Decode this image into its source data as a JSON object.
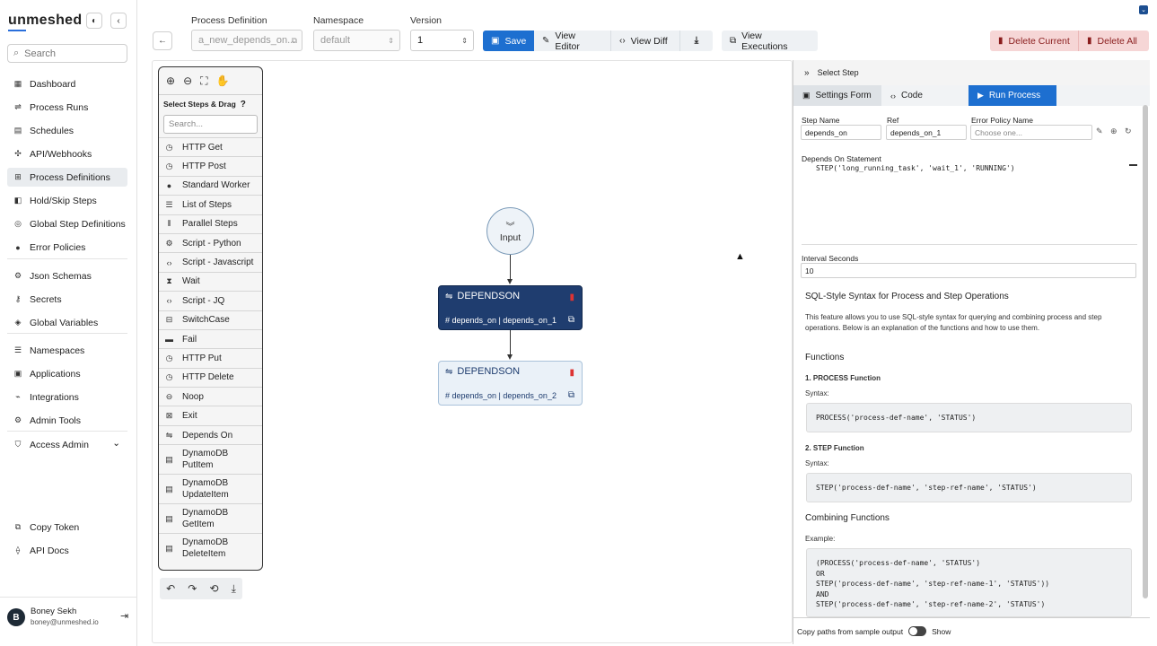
{
  "app": {
    "logo": "unmeshed"
  },
  "sidebar": {
    "search_placeholder": "Search",
    "items": [
      {
        "label": "Dashboard",
        "icon": "dashboard-icon"
      },
      {
        "label": "Process Runs",
        "icon": "runs-icon"
      },
      {
        "label": "Schedules",
        "icon": "calendar-icon"
      },
      {
        "label": "API/Webhooks",
        "icon": "webhook-icon"
      },
      {
        "label": "Process Definitions",
        "icon": "flow-icon",
        "active": true
      },
      {
        "label": "Hold/Skip Steps",
        "icon": "pause-icon"
      },
      {
        "label": "Global Step Definitions",
        "icon": "globe-icon"
      },
      {
        "label": "Error Policies",
        "icon": "warning-icon"
      },
      {
        "label": "Json Schemas",
        "icon": "schema-icon"
      },
      {
        "label": "Secrets",
        "icon": "key-icon"
      },
      {
        "label": "Global Variables",
        "icon": "variables-icon"
      },
      {
        "label": "Namespaces",
        "icon": "list-icon"
      },
      {
        "label": "Applications",
        "icon": "apps-icon"
      },
      {
        "label": "Integrations",
        "icon": "plug-icon"
      },
      {
        "label": "Admin Tools",
        "icon": "gear-icon"
      },
      {
        "label": "Access Admin",
        "icon": "shield-icon"
      }
    ],
    "bottom_items": [
      {
        "label": "Copy Token",
        "icon": "copy-icon"
      },
      {
        "label": "API Docs",
        "icon": "docs-icon"
      }
    ],
    "user": {
      "initial": "B",
      "name": "Boney Sekh",
      "email": "boney@unmeshed.io"
    }
  },
  "header": {
    "process_definition_label": "Process Definition",
    "process_definition_value": "a_new_depends_on...",
    "namespace_label": "Namespace",
    "namespace_value": "default",
    "version_label": "Version",
    "version_value": "1",
    "save": "Save",
    "view_editor": "View Editor",
    "view_diff": "View Diff",
    "view_executions": "View Executions",
    "delete_current": "Delete Current",
    "delete_all": "Delete All"
  },
  "palette": {
    "title": "Select Steps & Drag",
    "search_placeholder": "Search...",
    "items": [
      {
        "label": "HTTP Get",
        "icon": "http-icon"
      },
      {
        "label": "HTTP Post",
        "icon": "http-icon"
      },
      {
        "label": "Standard Worker",
        "icon": "worker-icon"
      },
      {
        "label": "List of Steps",
        "icon": "list-icon"
      },
      {
        "label": "Parallel Steps",
        "icon": "parallel-icon"
      },
      {
        "label": "Script - Python",
        "icon": "python-icon"
      },
      {
        "label": "Script - Javascript",
        "icon": "code-icon"
      },
      {
        "label": "Wait",
        "icon": "hourglass-icon"
      },
      {
        "label": "Script - JQ",
        "icon": "code-icon"
      },
      {
        "label": "SwitchCase",
        "icon": "switch-icon"
      },
      {
        "label": "Fail",
        "icon": "fail-icon"
      },
      {
        "label": "HTTP Put",
        "icon": "http-icon"
      },
      {
        "label": "HTTP Delete",
        "icon": "http-icon"
      },
      {
        "label": "Noop",
        "icon": "noop-icon"
      },
      {
        "label": "Exit",
        "icon": "exit-icon"
      },
      {
        "label": "Depends On",
        "icon": "link-icon"
      }
    ],
    "tall_items": [
      {
        "line1": "DynamoDB",
        "line2": "PutItem"
      },
      {
        "line1": "DynamoDB",
        "line2": "UpdateItem"
      },
      {
        "line1": "DynamoDB",
        "line2": "GetItem"
      },
      {
        "line1": "DynamoDB",
        "line2": "DeleteItem"
      }
    ]
  },
  "graph": {
    "input_label": "Input",
    "nodes": [
      {
        "title": "DEPENDSON",
        "sub": "# depends_on | depends_on_1",
        "selected": true
      },
      {
        "title": "DEPENDSON",
        "sub": "# depends_on | depends_on_2",
        "selected": false
      }
    ]
  },
  "panel": {
    "head": "Select Step",
    "tabs": {
      "settings": "Settings Form",
      "code": "Code",
      "run": "Run Process"
    },
    "step_name_label": "Step Name",
    "step_name_value": "depends_on",
    "ref_label": "Ref",
    "ref_value": "depends_on_1",
    "error_policy_label": "Error Policy Name",
    "error_policy_placeholder": "Choose one...",
    "depends_on_label": "Depends On Statement",
    "depends_on_value": "STEP('long_running_task', 'wait_1', 'RUNNING')",
    "interval_label": "Interval Seconds",
    "interval_value": "10",
    "doc_title": "SQL-Style Syntax for Process and Step Operations",
    "doc_intro": "This feature allows you to use SQL-style syntax for querying and combining process and step operations. Below is an explanation of the functions and how to use them.",
    "functions_heading": "Functions",
    "process_fn_title": "1. PROCESS Function",
    "syntax_label": "Syntax:",
    "process_fn_code": "PROCESS('process-def-name', 'STATUS')",
    "step_fn_title": "2. STEP Function",
    "step_fn_code": "STEP('process-def-name', 'step-ref-name', 'STATUS')",
    "combining_heading": "Combining Functions",
    "example_label": "Example:",
    "example_code": "(PROCESS('process-def-name', 'STATUS')\nOR\nSTEP('process-def-name', 'step-ref-name-1', 'STATUS'))\nAND\nSTEP('process-def-name', 'step-ref-name-2', 'STATUS')",
    "footer_text": "Copy paths from sample output",
    "footer_toggle": "Show"
  },
  "colors": {
    "primary": "#1d6fd0",
    "selected_node": "#1f3d6f",
    "danger_bg": "#f6d6d6"
  }
}
